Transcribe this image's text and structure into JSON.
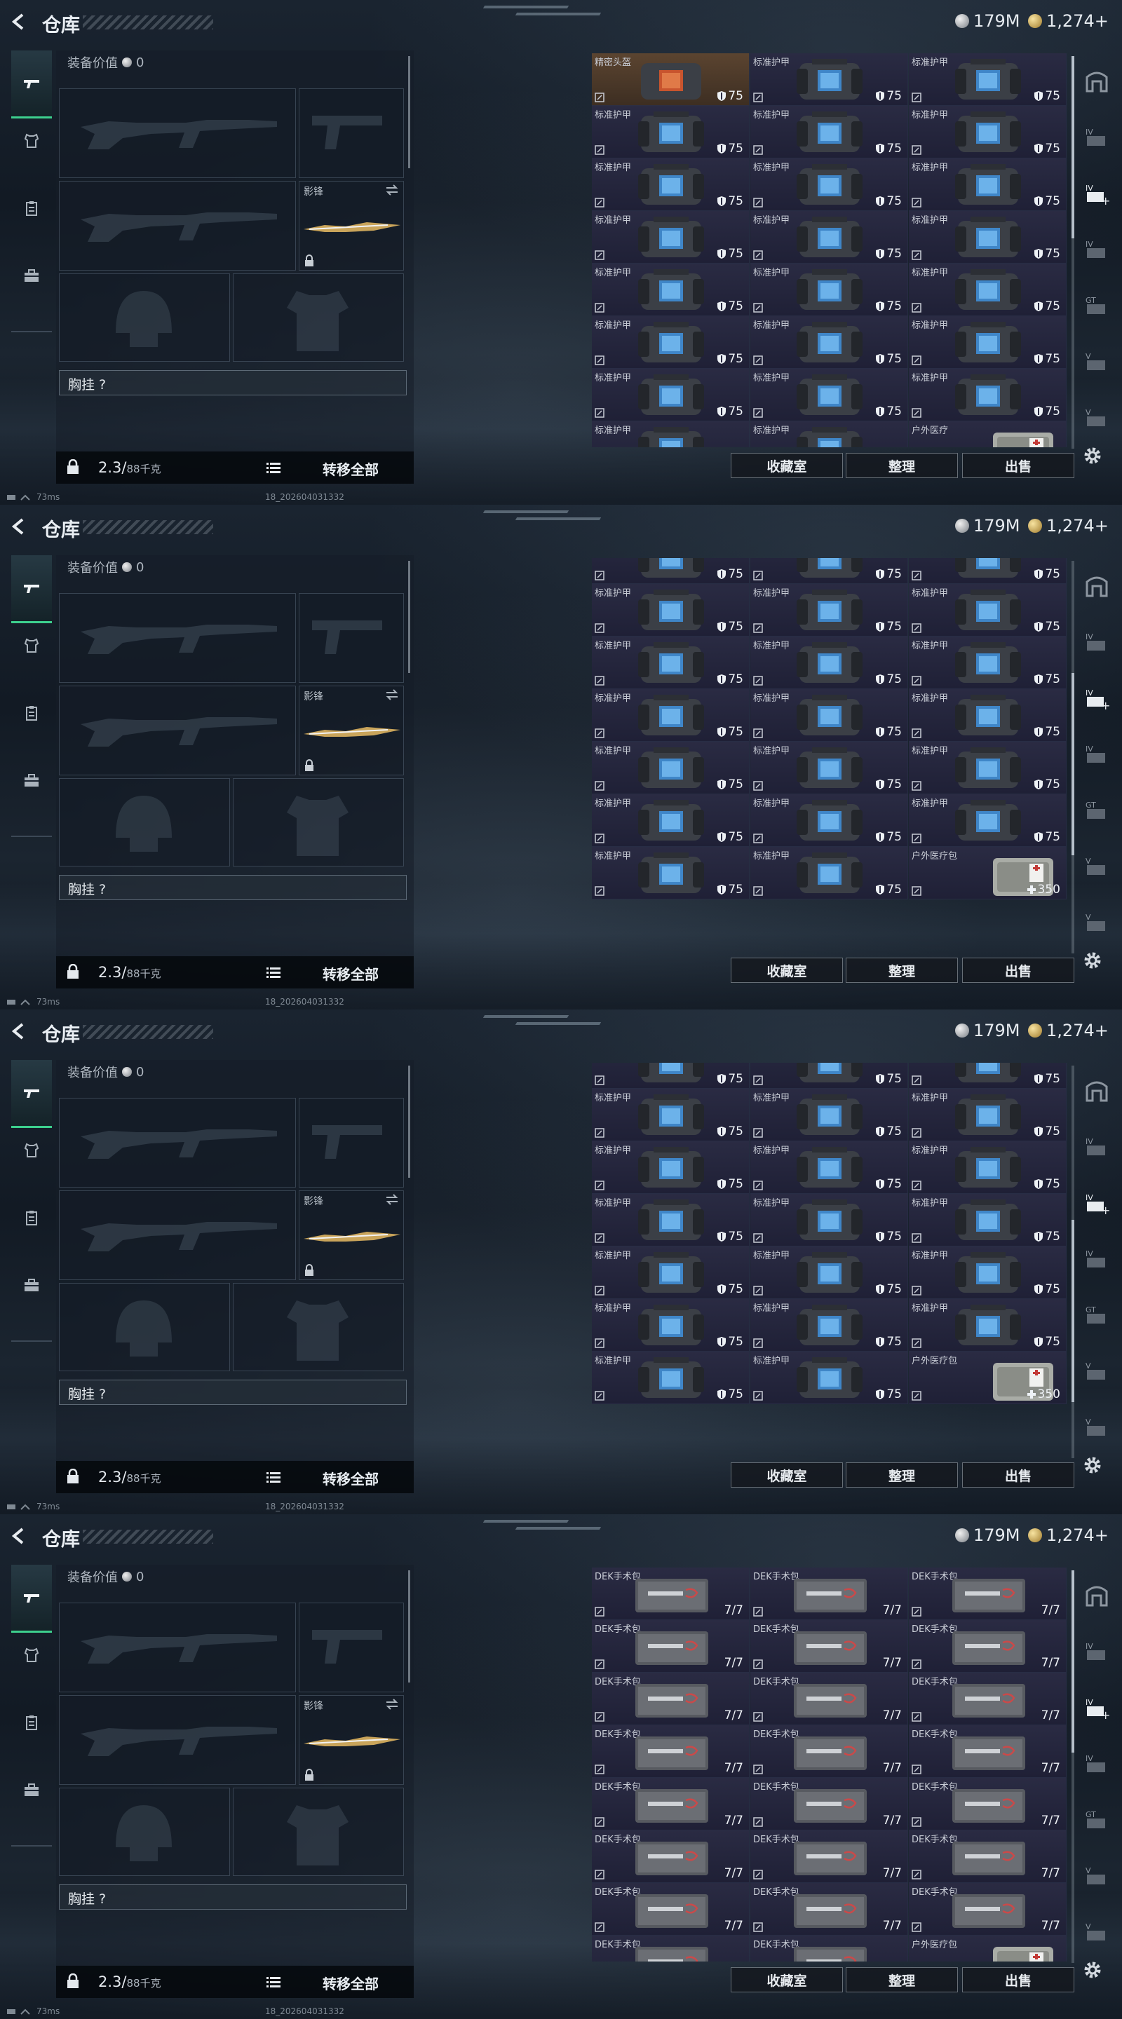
{
  "common": {
    "title": "仓库",
    "silver_amount": "179M",
    "gold_amount": "1,274+",
    "equipment_value_label": "装备价值",
    "equipment_value": "0",
    "weapon_slot_label": "影锋",
    "chest_rig_label": "胸挂 ?",
    "weight": "2.3/",
    "weight_capacity": "88千克",
    "transfer_all": "转移全部",
    "ping": "73ms",
    "uid": "18_202604031332",
    "buttons": {
      "collection": "收藏室",
      "organize": "整理",
      "sell": "出售"
    },
    "icons": {
      "back": "back-arrow-icon",
      "silver": "silver-coin-icon",
      "gold": "gold-coin-icon",
      "tabs": [
        "gun-icon",
        "armor-icon",
        "clipboard-icon",
        "briefcase-icon"
      ],
      "settings": "gear-icon"
    }
  },
  "screens": [
    {
      "rows": [
        [
          {
            "name": "精密头盔",
            "value": "75",
            "kind": "helmet",
            "highlight": true
          },
          {
            "name": "标准护甲",
            "value": "75",
            "kind": "armor"
          },
          {
            "name": "标准护甲",
            "value": "75",
            "kind": "armor"
          }
        ],
        [
          {
            "name": "标准护甲",
            "value": "75",
            "kind": "armor"
          },
          {
            "name": "标准护甲",
            "value": "75",
            "kind": "armor"
          },
          {
            "name": "标准护甲",
            "value": "75",
            "kind": "armor"
          }
        ],
        [
          {
            "name": "标准护甲",
            "value": "75",
            "kind": "armor"
          },
          {
            "name": "标准护甲",
            "value": "75",
            "kind": "armor"
          },
          {
            "name": "标准护甲",
            "value": "75",
            "kind": "armor"
          }
        ],
        [
          {
            "name": "标准护甲",
            "value": "75",
            "kind": "armor"
          },
          {
            "name": "标准护甲",
            "value": "75",
            "kind": "armor"
          },
          {
            "name": "标准护甲",
            "value": "75",
            "kind": "armor"
          }
        ],
        [
          {
            "name": "标准护甲",
            "value": "75",
            "kind": "armor"
          },
          {
            "name": "标准护甲",
            "value": "75",
            "kind": "armor"
          },
          {
            "name": "标准护甲",
            "value": "75",
            "kind": "armor"
          }
        ],
        [
          {
            "name": "标准护甲",
            "value": "75",
            "kind": "armor"
          },
          {
            "name": "标准护甲",
            "value": "75",
            "kind": "armor"
          },
          {
            "name": "标准护甲",
            "value": "75",
            "kind": "armor"
          }
        ],
        [
          {
            "name": "标准护甲",
            "value": "75",
            "kind": "armor"
          },
          {
            "name": "标准护甲",
            "value": "75",
            "kind": "armor"
          },
          {
            "name": "标准护甲",
            "value": "75",
            "kind": "armor"
          }
        ],
        [
          {
            "name": "标准护甲",
            "value": "",
            "kind": "armor"
          },
          {
            "name": "标准护甲",
            "value": "",
            "kind": "armor"
          },
          {
            "name": "户外医疗",
            "value": "",
            "kind": "medkit"
          }
        ]
      ]
    },
    {
      "rows": [
        [
          {
            "name": "",
            "value": "75",
            "kind": "armor"
          },
          {
            "name": "",
            "value": "75",
            "kind": "armor"
          },
          {
            "name": "",
            "value": "75",
            "kind": "armor"
          }
        ],
        [
          {
            "name": "标准护甲",
            "value": "75",
            "kind": "armor"
          },
          {
            "name": "标准护甲",
            "value": "75",
            "kind": "armor"
          },
          {
            "name": "标准护甲",
            "value": "75",
            "kind": "armor"
          }
        ],
        [
          {
            "name": "标准护甲",
            "value": "75",
            "kind": "armor"
          },
          {
            "name": "标准护甲",
            "value": "75",
            "kind": "armor"
          },
          {
            "name": "标准护甲",
            "value": "75",
            "kind": "armor"
          }
        ],
        [
          {
            "name": "标准护甲",
            "value": "75",
            "kind": "armor"
          },
          {
            "name": "标准护甲",
            "value": "75",
            "kind": "armor"
          },
          {
            "name": "标准护甲",
            "value": "75",
            "kind": "armor"
          }
        ],
        [
          {
            "name": "标准护甲",
            "value": "75",
            "kind": "armor"
          },
          {
            "name": "标准护甲",
            "value": "75",
            "kind": "armor"
          },
          {
            "name": "标准护甲",
            "value": "75",
            "kind": "armor"
          }
        ],
        [
          {
            "name": "标准护甲",
            "value": "75",
            "kind": "armor"
          },
          {
            "name": "标准护甲",
            "value": "75",
            "kind": "armor"
          },
          {
            "name": "标准护甲",
            "value": "75",
            "kind": "armor"
          }
        ],
        [
          {
            "name": "标准护甲",
            "value": "75",
            "kind": "armor"
          },
          {
            "name": "标准护甲",
            "value": "75",
            "kind": "armor"
          },
          {
            "name": "户外医疗包",
            "value": "350",
            "kind": "medkit"
          }
        ]
      ]
    },
    {
      "rows": [
        [
          {
            "name": "",
            "value": "75",
            "kind": "armor"
          },
          {
            "name": "",
            "value": "75",
            "kind": "armor"
          },
          {
            "name": "",
            "value": "75",
            "kind": "armor"
          }
        ],
        [
          {
            "name": "标准护甲",
            "value": "75",
            "kind": "armor"
          },
          {
            "name": "标准护甲",
            "value": "75",
            "kind": "armor"
          },
          {
            "name": "标准护甲",
            "value": "75",
            "kind": "armor"
          }
        ],
        [
          {
            "name": "标准护甲",
            "value": "75",
            "kind": "armor"
          },
          {
            "name": "标准护甲",
            "value": "75",
            "kind": "armor"
          },
          {
            "name": "标准护甲",
            "value": "75",
            "kind": "armor"
          }
        ],
        [
          {
            "name": "标准护甲",
            "value": "75",
            "kind": "armor"
          },
          {
            "name": "标准护甲",
            "value": "75",
            "kind": "armor"
          },
          {
            "name": "标准护甲",
            "value": "75",
            "kind": "armor"
          }
        ],
        [
          {
            "name": "标准护甲",
            "value": "75",
            "kind": "armor"
          },
          {
            "name": "标准护甲",
            "value": "75",
            "kind": "armor"
          },
          {
            "name": "标准护甲",
            "value": "75",
            "kind": "armor"
          }
        ],
        [
          {
            "name": "标准护甲",
            "value": "75",
            "kind": "armor"
          },
          {
            "name": "标准护甲",
            "value": "75",
            "kind": "armor"
          },
          {
            "name": "标准护甲",
            "value": "75",
            "kind": "armor"
          }
        ],
        [
          {
            "name": "标准护甲",
            "value": "75",
            "kind": "armor"
          },
          {
            "name": "标准护甲",
            "value": "75",
            "kind": "armor"
          },
          {
            "name": "户外医疗包",
            "value": "350",
            "kind": "medkit"
          }
        ]
      ]
    },
    {
      "rows": [
        [
          {
            "name": "DEK手术包",
            "value": "7/7",
            "kind": "surgery"
          },
          {
            "name": "DEK手术包",
            "value": "7/7",
            "kind": "surgery"
          },
          {
            "name": "DEK手术包",
            "value": "7/7",
            "kind": "surgery"
          }
        ],
        [
          {
            "name": "DEK手术包",
            "value": "7/7",
            "kind": "surgery"
          },
          {
            "name": "DEK手术包",
            "value": "7/7",
            "kind": "surgery"
          },
          {
            "name": "DEK手术包",
            "value": "7/7",
            "kind": "surgery"
          }
        ],
        [
          {
            "name": "DEK手术包",
            "value": "7/7",
            "kind": "surgery"
          },
          {
            "name": "DEK手术包",
            "value": "7/7",
            "kind": "surgery"
          },
          {
            "name": "DEK手术包",
            "value": "7/7",
            "kind": "surgery"
          }
        ],
        [
          {
            "name": "DEK手术包",
            "value": "7/7",
            "kind": "surgery"
          },
          {
            "name": "DEK手术包",
            "value": "7/7",
            "kind": "surgery"
          },
          {
            "name": "DEK手术包",
            "value": "7/7",
            "kind": "surgery"
          }
        ],
        [
          {
            "name": "DEK手术包",
            "value": "7/7",
            "kind": "surgery"
          },
          {
            "name": "DEK手术包",
            "value": "7/7",
            "kind": "surgery"
          },
          {
            "name": "DEK手术包",
            "value": "7/7",
            "kind": "surgery"
          }
        ],
        [
          {
            "name": "DEK手术包",
            "value": "7/7",
            "kind": "surgery"
          },
          {
            "name": "DEK手术包",
            "value": "7/7",
            "kind": "surgery"
          },
          {
            "name": "DEK手术包",
            "value": "7/7",
            "kind": "surgery"
          }
        ],
        [
          {
            "name": "DEK手术包",
            "value": "7/7",
            "kind": "surgery"
          },
          {
            "name": "DEK手术包",
            "value": "7/7",
            "kind": "surgery"
          },
          {
            "name": "DEK手术包",
            "value": "7/7",
            "kind": "surgery"
          }
        ],
        [
          {
            "name": "DEK手术包",
            "value": "",
            "kind": "surgery"
          },
          {
            "name": "DEK手术包",
            "value": "",
            "kind": "surgery"
          },
          {
            "name": "户外医疗包",
            "value": "",
            "kind": "medkit"
          }
        ]
      ]
    }
  ]
}
